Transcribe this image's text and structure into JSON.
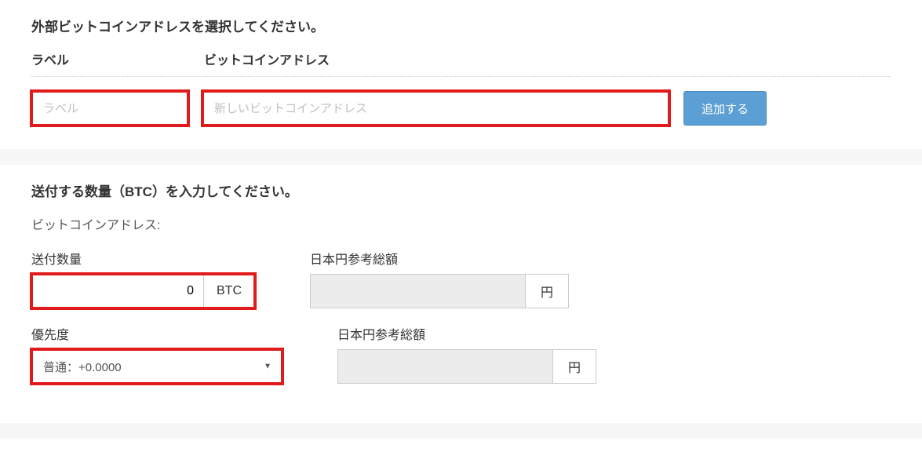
{
  "section1": {
    "title": "外部ビットコインアドレスを選択してください。",
    "header_label": "ラベル",
    "header_address": "ビットコインアドレス",
    "label_placeholder": "ラベル",
    "address_placeholder": "新しいビットコインアドレス",
    "add_button": "追加する"
  },
  "section2": {
    "title": "送付する数量（BTC）を入力してください。",
    "address_line": "ビットコインアドレス:",
    "qty_label": "送付数量",
    "qty_value": "0",
    "qty_unit": "BTC",
    "jpy_label": "日本円参考総額",
    "jpy_value": "",
    "jpy_unit": "円",
    "priority_label": "優先度",
    "priority_selected": "普通：+0.0000",
    "jpy2_label": "日本円参考総額",
    "jpy2_value": "",
    "jpy2_unit": "円"
  }
}
